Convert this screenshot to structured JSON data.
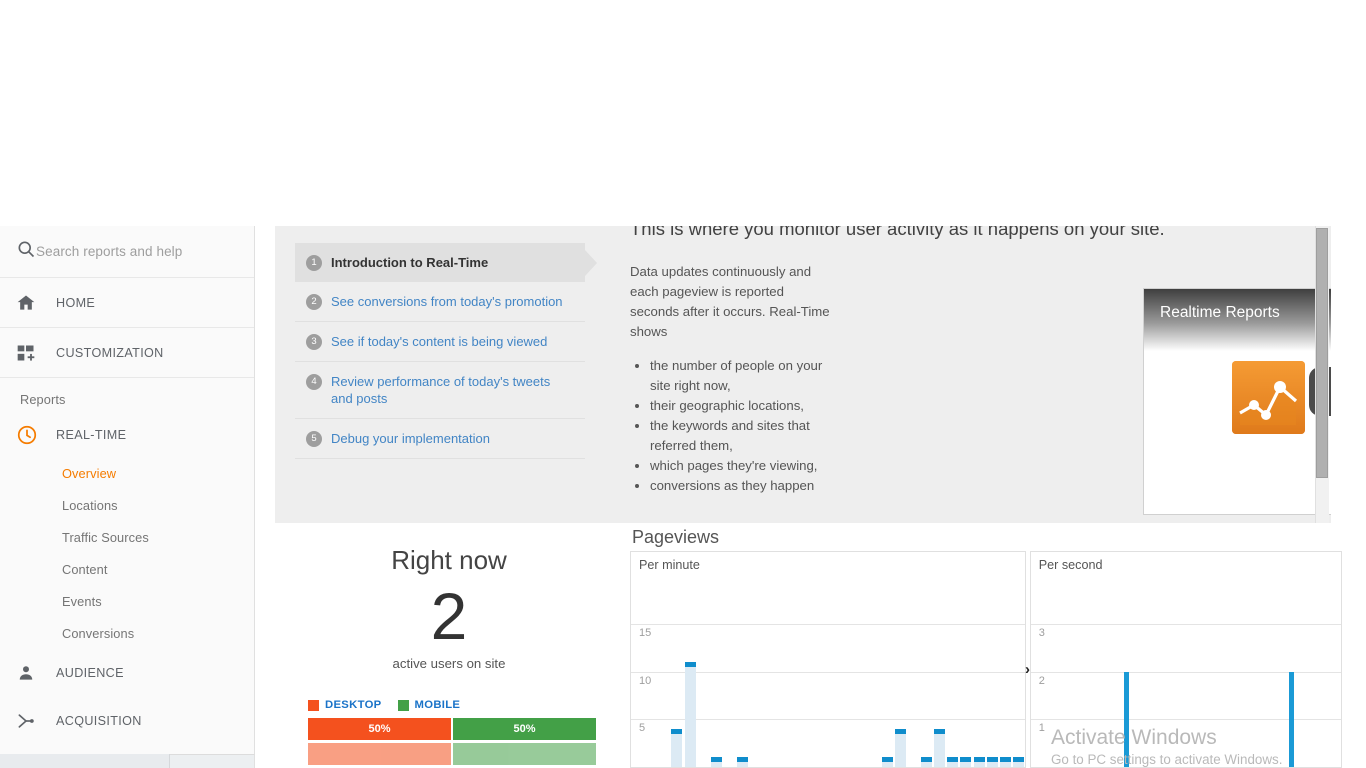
{
  "sidebar": {
    "search": {
      "placeholder": "Search reports and help",
      "icon": "search-icon"
    },
    "home": {
      "label": "HOME",
      "icon": "home-icon"
    },
    "customization": {
      "label": "CUSTOMIZATION",
      "icon": "customization-icon"
    },
    "reports_label": "Reports",
    "realtime": {
      "label": "REAL-TIME",
      "icon": "clock-icon",
      "color": "#f57c00"
    },
    "sub_items": [
      {
        "label": "Overview",
        "active": true
      },
      {
        "label": "Locations",
        "active": false
      },
      {
        "label": "Traffic Sources",
        "active": false
      },
      {
        "label": "Content",
        "active": false
      },
      {
        "label": "Events",
        "active": false
      },
      {
        "label": "Conversions",
        "active": false
      }
    ],
    "audience": {
      "label": "AUDIENCE",
      "icon": "person-icon"
    },
    "acquisition": {
      "label": "ACQUISITION",
      "icon": "share-nodes-icon"
    }
  },
  "intro": {
    "steps": [
      {
        "num": "1",
        "label": "Introduction to Real-Time"
      },
      {
        "num": "2",
        "label": "See conversions from today's promotion"
      },
      {
        "num": "3",
        "label": "See if today's content is being viewed"
      },
      {
        "num": "4",
        "label": "Review performance of today's tweets and posts"
      },
      {
        "num": "5",
        "label": "Debug your implementation"
      }
    ],
    "heading": "This is where you monitor user activity as it happens on your site.",
    "paragraph": "Data updates continuously and each pageview is reported seconds after it occurs. Real-Time shows",
    "bullets": [
      "the number of people on your site right now,",
      "their geographic locations,",
      "the keywords and sites that referred them,",
      "which pages they're viewing,",
      "conversions as they happen"
    ],
    "video": {
      "title": "Realtime Reports",
      "word": "Realtime",
      "clock_icon": "watch-later-icon",
      "share_icon": "share-icon",
      "play_icon": "play-button-icon"
    }
  },
  "right_now": {
    "title": "Right now",
    "count": "2",
    "subtitle": "active users on site",
    "legend": [
      {
        "label": "DESKTOP",
        "color": "#f4511e",
        "percent": "50%"
      },
      {
        "label": "MOBILE",
        "color": "#43a047",
        "percent": "50%"
      }
    ]
  },
  "pageviews": {
    "title": "Pageviews",
    "per_minute_label": "Per minute",
    "per_second_label": "Per second",
    "chevron": "›"
  },
  "watermark": {
    "line1": "Activate Windows",
    "line2": "Go to PC settings to activate Windows."
  },
  "chart_data": [
    {
      "type": "bar",
      "title": "Pageviews",
      "subtitle": "Per minute",
      "xlabel": "",
      "ylabel": "",
      "ylim": [
        0,
        20
      ],
      "yticks": [
        5,
        10,
        15
      ],
      "grid": true,
      "categories": [
        "-30",
        "-29",
        "-28",
        "-27",
        "-26",
        "-25",
        "-24",
        "-23",
        "-22",
        "-21",
        "-20",
        "-19",
        "-18",
        "-17",
        "-16",
        "-15",
        "-14",
        "-13",
        "-12",
        "-11",
        "-10",
        "-9",
        "-8",
        "-7",
        "-6",
        "-5",
        "-4",
        "-3",
        "-2",
        "-1"
      ],
      "values": [
        0,
        0,
        0,
        4,
        11,
        0,
        1,
        0,
        1,
        0,
        0,
        0,
        0,
        0,
        0,
        0,
        0,
        0,
        0,
        1,
        4,
        0,
        1,
        4,
        1,
        1,
        1,
        1,
        1,
        1
      ]
    },
    {
      "type": "bar",
      "title": "Pageviews",
      "subtitle": "Per second",
      "xlabel": "",
      "ylabel": "",
      "ylim": [
        0,
        4
      ],
      "yticks": [
        1,
        2,
        3
      ],
      "grid": true,
      "categories": [
        "-60",
        "-59",
        "-58",
        "-57",
        "-56",
        "-55",
        "-54",
        "-53",
        "-52",
        "-51",
        "-50",
        "-49",
        "-48",
        "-47",
        "-46",
        "-45",
        "-44",
        "-43",
        "-42",
        "-41",
        "-40",
        "-39",
        "-38",
        "-37",
        "-36",
        "-35",
        "-34",
        "-33",
        "-32",
        "-31",
        "-30",
        "-29",
        "-28",
        "-27",
        "-26",
        "-25",
        "-24",
        "-23",
        "-22",
        "-21",
        "-20",
        "-19",
        "-18",
        "-17",
        "-16",
        "-15",
        "-14",
        "-13",
        "-12",
        "-11",
        "-10",
        "-9",
        "-8",
        "-7",
        "-6",
        "-5",
        "-4",
        "-3",
        "-2",
        "-1"
      ],
      "values": [
        0,
        0,
        0,
        0,
        0,
        0,
        0,
        0,
        0,
        0,
        0,
        0,
        0,
        0,
        0,
        0,
        0,
        0,
        2,
        0,
        0,
        0,
        0,
        0,
        0,
        0,
        0,
        0,
        0,
        0,
        0,
        0,
        0,
        0,
        0,
        0,
        0,
        0,
        0,
        0,
        0,
        0,
        0,
        0,
        0,
        0,
        0,
        0,
        0,
        0,
        2,
        0,
        0,
        0,
        0,
        0,
        0,
        0,
        0,
        0
      ]
    }
  ]
}
